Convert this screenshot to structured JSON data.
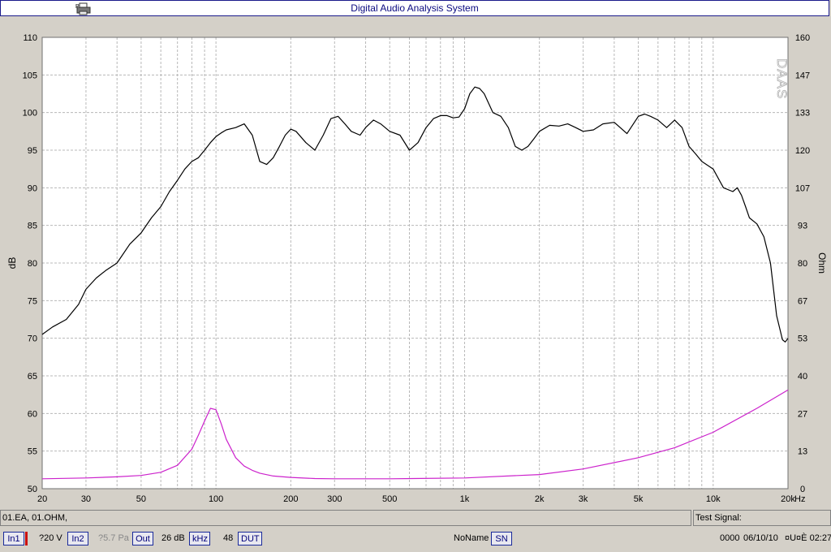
{
  "window": {
    "title": "Digital Audio Analysis System"
  },
  "icons": {
    "printer": "printer-icon"
  },
  "chart_data": {
    "type": "line",
    "watermark": "DAAS",
    "xscale": "log",
    "xlim": [
      20,
      20000
    ],
    "ylabel": "dB",
    "ylim": [
      50,
      110
    ],
    "y2label": "Ohm",
    "xtick_values": [
      20,
      30,
      50,
      100,
      200,
      300,
      500,
      1000,
      2000,
      3000,
      5000,
      10000,
      20000
    ],
    "xtick_labels": [
      "20",
      "30",
      "50",
      "100",
      "200",
      "300",
      "500",
      "1k",
      "2k",
      "3k",
      "5k",
      "10k",
      "20k"
    ],
    "xunit": "Hz",
    "ytick_labels": [
      "110",
      "105",
      "100",
      "95",
      "90",
      "85",
      "80",
      "75",
      "70",
      "65",
      "60",
      "55",
      "50"
    ],
    "y2tick_labels": [
      "160",
      "147",
      "133",
      "120",
      "107",
      "93",
      "80",
      "67",
      "53",
      "40",
      "27",
      "13",
      "0"
    ],
    "grid": true,
    "series": [
      {
        "color": "#000000",
        "x": [
          20,
          22,
          25,
          28,
          30,
          33,
          36,
          40,
          45,
          50,
          55,
          60,
          65,
          70,
          75,
          80,
          85,
          90,
          95,
          100,
          105,
          110,
          120,
          130,
          140,
          150,
          160,
          170,
          180,
          190,
          200,
          210,
          230,
          250,
          270,
          290,
          310,
          330,
          350,
          380,
          400,
          430,
          460,
          500,
          550,
          600,
          650,
          700,
          750,
          800,
          850,
          900,
          950,
          1000,
          1050,
          1100,
          1150,
          1200,
          1300,
          1400,
          1500,
          1600,
          1700,
          1800,
          1900,
          2000,
          2200,
          2400,
          2600,
          2800,
          3000,
          3300,
          3600,
          4000,
          4500,
          5000,
          5300,
          5600,
          6000,
          6500,
          7000,
          7500,
          8000,
          8500,
          9000,
          10000,
          11000,
          12000,
          12500,
          13000,
          13500,
          14000,
          15000,
          16000,
          17000,
          18000,
          19000,
          19500,
          20000
        ],
        "y": [
          70.5,
          71.5,
          72.5,
          74.5,
          76.5,
          78.0,
          79.0,
          80.0,
          82.5,
          84.0,
          86.0,
          87.5,
          89.5,
          91.0,
          92.5,
          93.5,
          94.0,
          95.0,
          96.0,
          96.8,
          97.3,
          97.7,
          98.0,
          98.5,
          97.0,
          93.5,
          93.1,
          94.0,
          95.5,
          97.0,
          97.8,
          97.5,
          96.0,
          95.0,
          97.0,
          99.2,
          99.5,
          98.5,
          97.5,
          97.0,
          98.0,
          99.0,
          98.5,
          97.5,
          97.0,
          95.0,
          96.0,
          98.0,
          99.2,
          99.6,
          99.6,
          99.3,
          99.4,
          100.5,
          102.5,
          103.4,
          103.2,
          102.5,
          100.0,
          99.5,
          98.0,
          95.5,
          95.0,
          95.5,
          96.5,
          97.5,
          98.3,
          98.2,
          98.5,
          98.0,
          97.5,
          97.7,
          98.5,
          98.7,
          97.2,
          99.5,
          99.8,
          99.5,
          99.0,
          98.0,
          99.0,
          98.0,
          95.5,
          94.5,
          93.5,
          92.5,
          90.0,
          89.5,
          90.0,
          89.0,
          87.5,
          86.0,
          85.2,
          83.5,
          80.0,
          73.0,
          69.8,
          69.5,
          70.0
        ]
      },
      {
        "color": "#cc22cc",
        "x": [
          20,
          30,
          40,
          50,
          60,
          70,
          80,
          85,
          90,
          95,
          100,
          105,
          110,
          120,
          130,
          140,
          150,
          170,
          200,
          250,
          300,
          500,
          1000,
          2000,
          3000,
          5000,
          7000,
          10000,
          15000,
          20000
        ],
        "y": [
          3.5,
          3.8,
          4.2,
          4.7,
          5.8,
          8.3,
          14.0,
          19.0,
          24.0,
          28.5,
          28.0,
          23.0,
          17.5,
          11.0,
          8.0,
          6.5,
          5.5,
          4.5,
          4.0,
          3.6,
          3.5,
          3.5,
          3.8,
          5.0,
          7.0,
          11.0,
          14.5,
          20.0,
          28.5,
          35.0
        ]
      }
    ]
  },
  "file_bar": {
    "text": "01.EA, 01.OHM,"
  },
  "signal_bar": {
    "label": "Test Signal:"
  },
  "status": {
    "in1": "In1",
    "voltage": "?20 V",
    "in2": "In2",
    "pressure": "?5.7 Pa",
    "out": "Out",
    "gain": "26 dB",
    "khz": "kHz",
    "rate": "48",
    "dut": "DUT",
    "name": "NoName",
    "sn": "SN",
    "counter": "0000",
    "date": "06/10/10",
    "time": "¤U¤È 02:27:"
  }
}
